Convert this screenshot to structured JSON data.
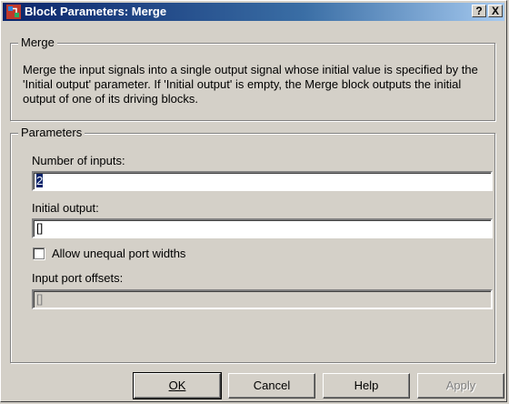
{
  "window": {
    "title": "Block Parameters: Merge",
    "help_glyph": "?",
    "close_glyph": "X"
  },
  "description_group": {
    "legend": "Merge",
    "text": "Merge the input signals into a single output signal whose initial value is specified by the 'Initial output' parameter. If 'Initial output' is empty, the Merge block outputs the initial output of one of its driving blocks."
  },
  "parameters_group": {
    "legend": "Parameters",
    "number_of_inputs": {
      "label": "Number of inputs:",
      "value": "2"
    },
    "initial_output": {
      "label": "Initial output:",
      "value": "[]"
    },
    "allow_unequal": {
      "label": "Allow unequal port widths",
      "checked": false
    },
    "input_port_offsets": {
      "label": "Input port offsets:",
      "value": "[]",
      "enabled": false
    }
  },
  "buttons": {
    "ok": "OK",
    "cancel": "Cancel",
    "help": "Help",
    "apply": "Apply"
  }
}
